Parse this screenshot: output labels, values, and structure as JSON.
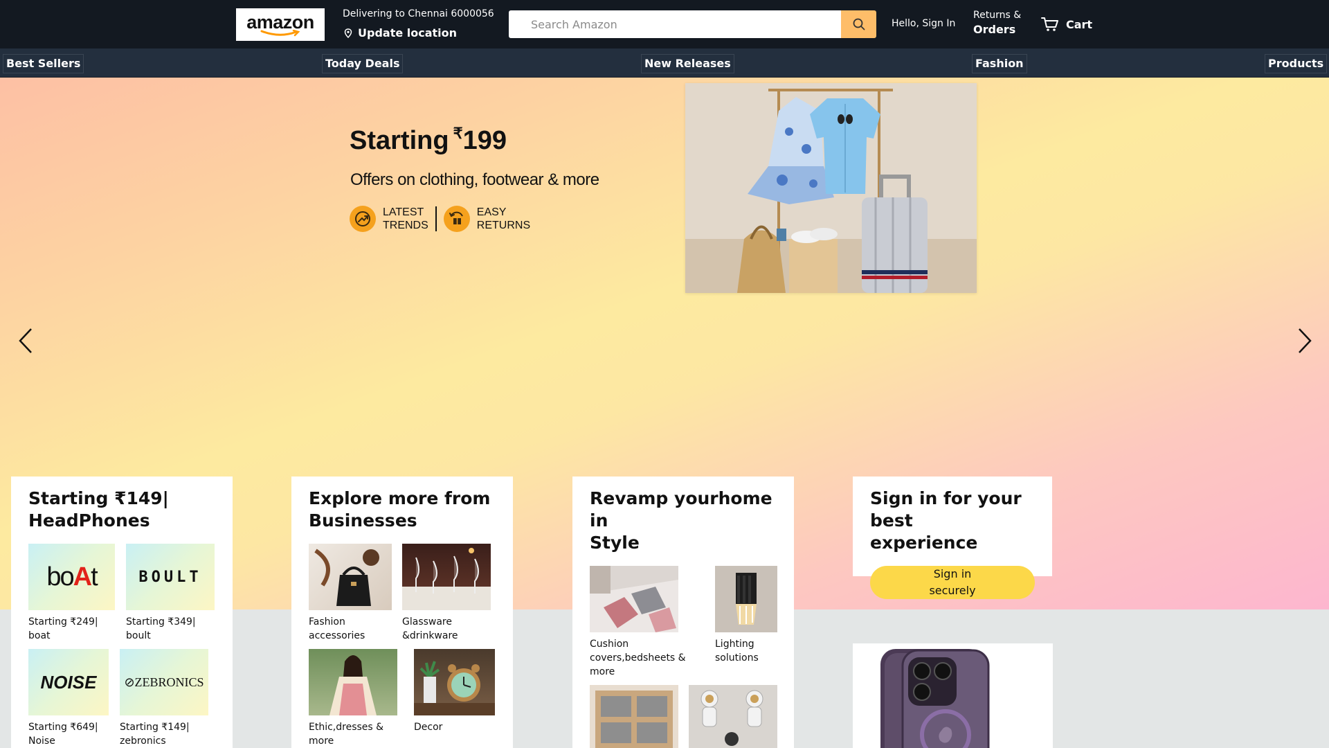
{
  "header": {
    "logo_text": "amazon",
    "delivering_to": "Delivering to Chennai 6000056",
    "update_location": "Update location",
    "search_placeholder": "Search Amazon",
    "hello_signin": "Hello, Sign In",
    "returns_line1": "Returns &",
    "returns_line2": "Orders",
    "cart_label": "Cart"
  },
  "nav": {
    "items": [
      "Best Sellers",
      "Today Deals",
      "New Releases",
      "Fashion",
      "Products"
    ]
  },
  "hero": {
    "title": "Starting",
    "rupee": "₹",
    "price": "199",
    "subtitle": "Offers on clothing, footwear & more",
    "badge1_line1": "LATEST",
    "badge1_line2": "TRENDS",
    "badge2_line1": "EASY",
    "badge2_line2": "RETURNS"
  },
  "cards": {
    "headphones": {
      "title_line1": "Starting ₹149|",
      "title_line2": "HeadPhones",
      "items": [
        {
          "brand": "boAt",
          "cap1": "Starting ₹249|",
          "cap2": "boat"
        },
        {
          "brand": "BOULT",
          "cap1": "Starting ₹349|",
          "cap2": "boult"
        },
        {
          "brand": "NOISE",
          "cap1": "Starting ₹649|",
          "cap2": "Noise"
        },
        {
          "brand": "ZEBRONICS",
          "cap1": "Starting ₹149|",
          "cap2": "zebronics"
        }
      ]
    },
    "businesses": {
      "title_line1": "Explore more from",
      "title_line2": "Businesses",
      "items": [
        {
          "cap1": "Fashion",
          "cap2": "accessories"
        },
        {
          "cap1": "Glassware",
          "cap2": "&drinkware"
        },
        {
          "cap1": "Ethic,dresses &",
          "cap2": "more"
        },
        {
          "cap1": "Decor",
          "cap2": ""
        }
      ]
    },
    "revamp": {
      "title_line1": "Revamp yourhome",
      "title_line2": "in",
      "title_line3": "Style",
      "items": [
        {
          "cap1": "Cushion",
          "cap2": "covers,bedsheets &",
          "cap3": "more"
        },
        {
          "cap1": "Lighting",
          "cap2": "solutions"
        }
      ]
    },
    "signin": {
      "title_line1": "Sign in for your",
      "title_line2": "best",
      "title_line3": "experience",
      "button_line1": "Sign in",
      "button_line2": "securely"
    }
  },
  "colors": {
    "header_bg": "#131921",
    "nav_bg": "#232f3e",
    "search_button": "#febd69",
    "signin_button": "#fcd849",
    "badge_orange": "#f5a11d",
    "page_bg": "#e3e6e6"
  },
  "icons": {
    "location": "map-pin-icon",
    "search": "search-icon",
    "cart": "cart-icon",
    "prev": "chevron-left-icon",
    "next": "chevron-right-icon"
  }
}
